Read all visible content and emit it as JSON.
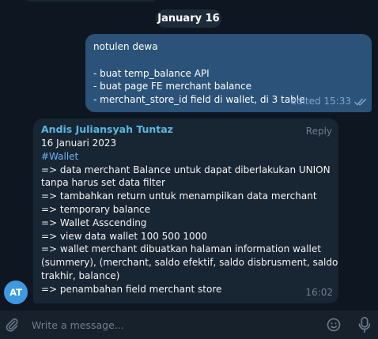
{
  "chat": {
    "date_separator": "January 16",
    "outgoing": {
      "lines": [
        "notulen dewa",
        "",
        "- buat temp_balance API",
        "- buat page FE merchant balance",
        "- merchant_store_id field di wallet, di 3 table"
      ],
      "status": "edited 15:33"
    },
    "incoming": {
      "avatar_initials": "AT",
      "sender": "Andis Juliansyah Tuntaz",
      "reply_label": "Reply",
      "date_line": "16 Januari 2023",
      "hashtag": "#Wallet",
      "lines": [
        "=> data merchant Balance untuk dapat diberlakukan UNION",
        "tanpa harus set data filter",
        "=> tambahkan return untuk menampilkan data merchant",
        "=> temporary balance",
        "=> Wallet Asscending",
        "=> view data wallet 100 500 1000",
        "=> wallet merchant dibuatkan halaman information wallet",
        "(summery), (merchant, saldo efektif, saldo disbrusment, saldo",
        "trakhir, balance)",
        "=> penambahan field merchant store"
      ],
      "time": "16:02"
    }
  },
  "composer": {
    "placeholder": "Write a message...",
    "attach_icon": "paperclip-icon",
    "emoji_icon": "smiley-icon",
    "voice_icon": "microphone-icon"
  },
  "colors": {
    "background": "#0e1621",
    "outgoing_bubble": "#2b5278",
    "incoming_bubble": "#182533",
    "sender_name": "#5ab8e0",
    "hashtag": "#6ab3f3",
    "avatar": "#3d9ae0",
    "composer_bar": "#17212b"
  }
}
